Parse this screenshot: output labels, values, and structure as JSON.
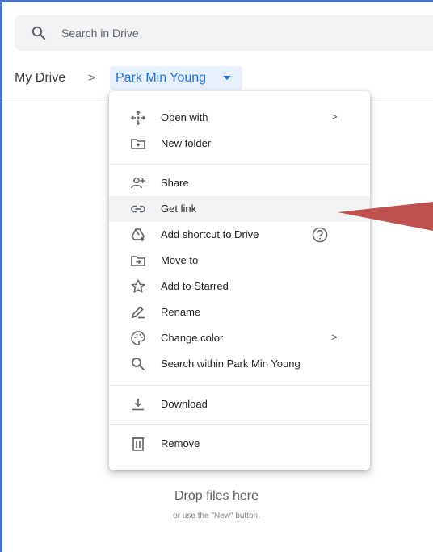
{
  "search": {
    "placeholder": "Search in Drive",
    "icon": "search-icon"
  },
  "breadcrumb": {
    "root": "My Drive",
    "separator": ">",
    "current": "Park Min Young"
  },
  "context_menu": {
    "items": [
      {
        "label": "Open with",
        "icon": "open-with-icon",
        "submenu": true
      },
      {
        "label": "New folder",
        "icon": "new-folder-icon"
      },
      {
        "label": "Share",
        "icon": "share-icon"
      },
      {
        "label": "Get link",
        "icon": "link-icon",
        "highlighted": true
      },
      {
        "label": "Add shortcut to Drive",
        "icon": "add-shortcut-icon",
        "help": true
      },
      {
        "label": "Move to",
        "icon": "move-to-icon"
      },
      {
        "label": "Add to Starred",
        "icon": "star-icon"
      },
      {
        "label": "Rename",
        "icon": "rename-icon"
      },
      {
        "label": "Change color",
        "icon": "palette-icon",
        "submenu": true
      },
      {
        "label": "Search within Park Min Young",
        "icon": "search-icon"
      },
      {
        "label": "Download",
        "icon": "download-icon"
      },
      {
        "label": "Remove",
        "icon": "trash-icon"
      }
    ],
    "submenu_arrow": ">"
  },
  "drop_zone": {
    "title": "Drop files here",
    "subtitle": "or use the \"New\" button."
  },
  "colors": {
    "accent": "#1a73e8",
    "highlight_bg": "#f1f3f4",
    "pointer_arrow": "#c0504d",
    "frame_border": "#4a72c4"
  }
}
